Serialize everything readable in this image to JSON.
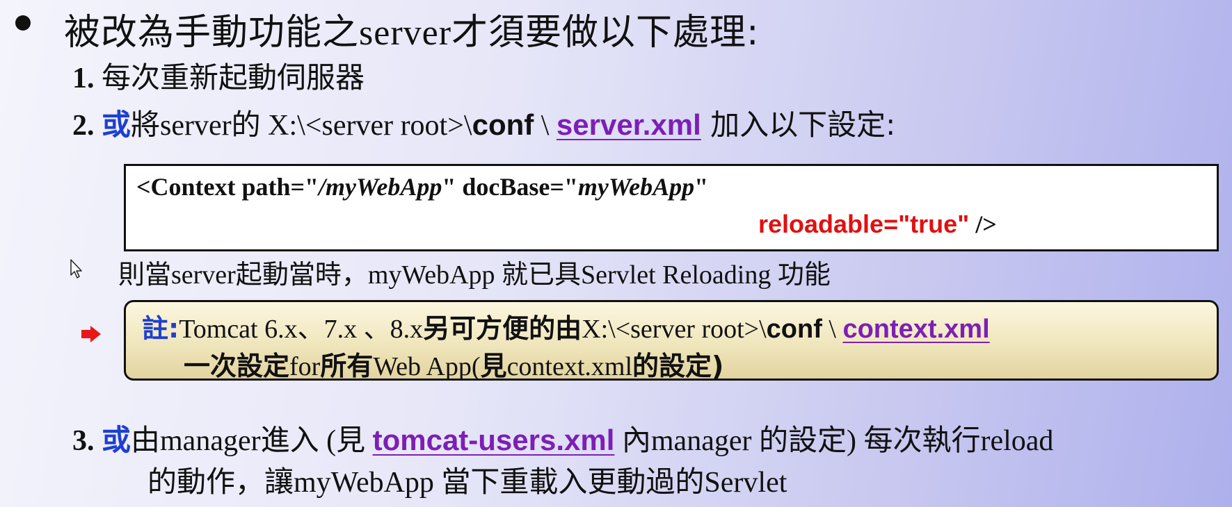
{
  "title": {
    "cjk": "被改為手動功能之",
    "latin": "server",
    "cjk2": "才須要做以下處理:"
  },
  "item1": {
    "num": "1.",
    "text": "每次重新起動伺服器"
  },
  "item2": {
    "num": "2.",
    "or": "或",
    "text1": "將server的 X:\\<server root>\\",
    "conf": "conf",
    "sep": " \\ ",
    "link": "server.xml",
    "text2": " 加入以下設定:"
  },
  "code": {
    "line1_a": "<Context path=\"",
    "line1_b": "/myWebApp",
    "line1_c": "\" docBase=\"",
    "line1_d": "myWebApp",
    "line1_e": "\"",
    "line2_red": "reloadable=\"true\"",
    "line2_end": " />"
  },
  "result_text": "則當server起動當時，myWebApp 就已具Servlet Reloading 功能",
  "note": {
    "label": "註:",
    "line1_a": "Tomcat 6.x、7.x 、8.x",
    "line1_b": "另可方便的由",
    "line1_c": "X:\\<server root>\\",
    "conf": "conf",
    "sep": " \\ ",
    "link": "context.xml",
    "line2_a": "一次設定",
    "line2_b": "for",
    "line2_c": "所有",
    "line2_d": "Web App(",
    "line2_e": "見",
    "line2_f": "context.xml",
    "line2_g": "的設定)"
  },
  "item3": {
    "num": "3.",
    "or": "或",
    "text1": "由manager進入 (見 ",
    "link": "tomcat-users.xml",
    "text2": " 內manager 的設定) 每次執行reload",
    "line2": "的動作，讓myWebApp 當下重載入更動過的Servlet"
  },
  "colors": {
    "accent_blue": "#1e3fd0",
    "link_purple": "#7c1fb5",
    "red": "#e01010",
    "arrow_red": "#e81818"
  },
  "icons": {
    "cursor": "mouse-pointer-icon",
    "arrow": "right-arrow-icon"
  }
}
